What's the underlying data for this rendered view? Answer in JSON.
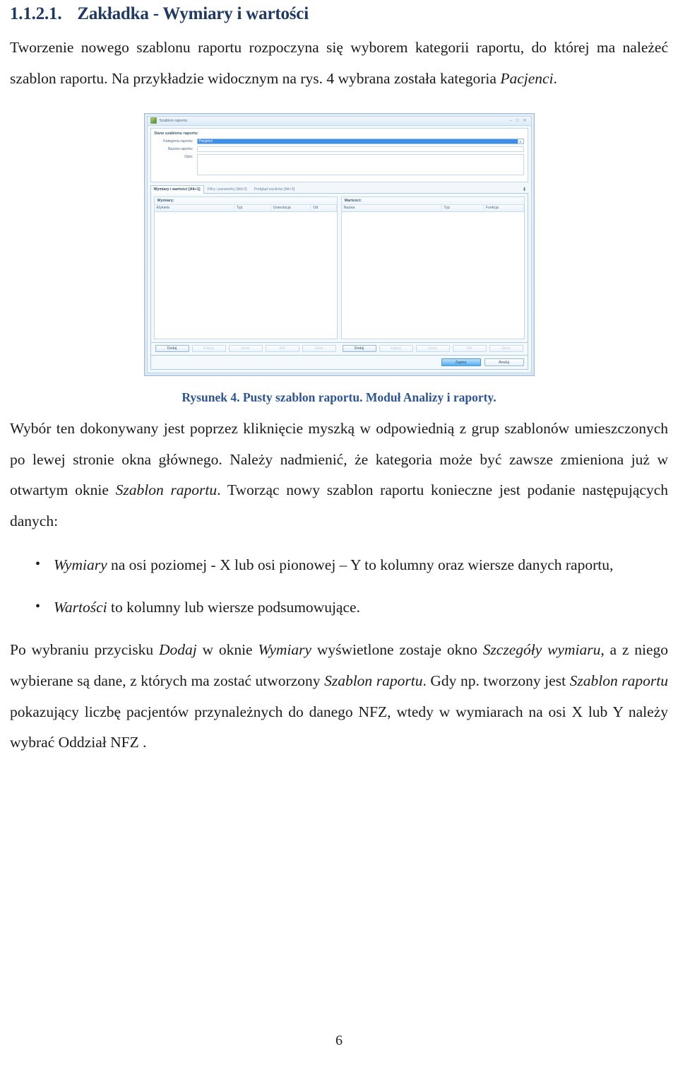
{
  "heading": {
    "number": "1.1.2.1.",
    "title": "Zakładka - Wymiary i wartości"
  },
  "paragraphs": {
    "intro_1": "Tworzenie nowego szablonu raportu rozpoczyna się wyborem kategorii raportu, do której ma należeć szablon raportu. Na przykładzie widocznym na rys. 4 wybrana została kategoria ",
    "intro_1_em": "Pacjenci",
    "intro_1_end": ".",
    "after_fig_a": "Wybór ten dokonywany jest poprzez kliknięcie myszką w odpowiednią z grup szablonów umieszczonych po lewej stronie okna głównego. Należy nadmienić, że kategoria może być zawsze zmieniona już w otwartym oknie ",
    "after_fig_a_em": "Szablon raportu",
    "after_fig_a_end": ". Tworząc nowy szablon raportu konieczne jest podanie następujących danych:",
    "last_a": "Po wybraniu przycisku  ",
    "last_em1": "Dodaj",
    "last_b": " w oknie ",
    "last_em2": "Wymiary",
    "last_c": " wyświetlone zostaje okno ",
    "last_em3": "Szczegóły wymiaru",
    "last_d": ", a z niego wybierane są  dane, z których ma zostać utworzony ",
    "last_em4": "Szablon raportu",
    "last_e": ". Gdy np. tworzony jest ",
    "last_em5": "Szablon raportu",
    "last_f": " pokazujący liczbę pacjentów przynależnych do danego NFZ, wtedy w wymiarach na osi X lub Y należy wybrać Oddział NFZ ."
  },
  "bullets": [
    {
      "marker": "•",
      "em": "Wymiary",
      "text": " na osi poziomej - X lub osi pionowej – Y to kolumny oraz wiersze danych raportu,"
    },
    {
      "marker": "•",
      "em": "Wartości",
      "text": " to kolumny lub wiersze podsumowujące."
    }
  ],
  "figure": {
    "caption": "Rysunek 4. Pusty szablon raportu. Moduł Analizy i raporty."
  },
  "app_window": {
    "title": "Szablon raportu",
    "controls": {
      "minimize": "–",
      "maximize": "□",
      "close": "✕"
    },
    "group_title": "Dane szablonu raportu:",
    "fields": [
      {
        "label": "Kategoria raportu:",
        "value": "Pacjenci",
        "type": "combo"
      },
      {
        "label": "Nazwa raportu:",
        "value": "",
        "type": "text"
      },
      {
        "label": "Opis:",
        "value": "",
        "type": "memo"
      }
    ],
    "tabs": [
      {
        "label": "Wymiary i wartości [Alt+1]",
        "active": true
      },
      {
        "label": "Filtry i parametry [Alt+2]",
        "active": false
      },
      {
        "label": "Podgląd wyników [Alt+3]",
        "active": false
      }
    ],
    "tab_overflow_icon": "chevron-down-icon",
    "panes": [
      {
        "title": "Wymiary:",
        "columns": [
          "Etykieta",
          "Typ",
          "Granulacja",
          "Od"
        ],
        "rows": [],
        "buttons": [
          "Dodaj",
          "Edytuj",
          "Usuń",
          "Dół",
          "Góra"
        ]
      },
      {
        "title": "Wartości:",
        "columns": [
          "Nazwa",
          "Typ",
          "Funkcja"
        ],
        "rows": [],
        "buttons": [
          "Dodaj",
          "Edytuj",
          "Usuń",
          "Dół",
          "Góra"
        ]
      }
    ],
    "footer_buttons": [
      {
        "label": "Zapisz",
        "primary": true
      },
      {
        "label": "Anuluj",
        "primary": false
      }
    ]
  },
  "page_number": "6",
  "colors": {
    "heading": "#1F3864",
    "caption": "#2E5496",
    "accent": "#2f86e8",
    "window_border": "#9ab6d6"
  }
}
